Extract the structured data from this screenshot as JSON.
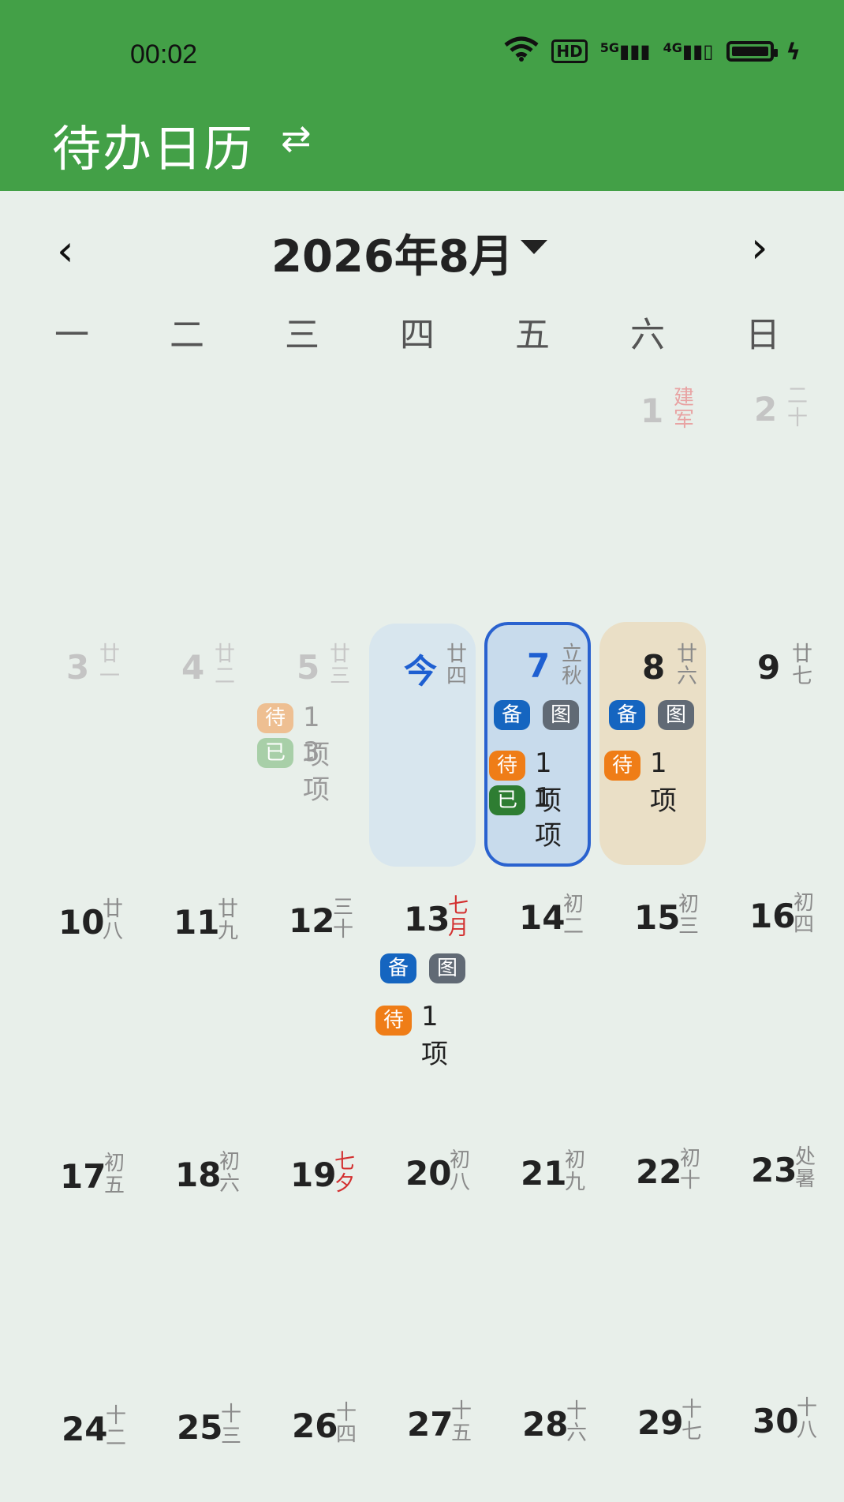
{
  "status": {
    "time": "00:02",
    "icons": [
      "wifi-icon",
      "hd-icon",
      "signal-5g-icon",
      "signal-4g-icon",
      "battery-icon",
      "charging-icon"
    ],
    "hd_label": "HD",
    "g5_label": "5G",
    "g4_label": "4G"
  },
  "appbar": {
    "title": "待办日历",
    "swap_icon": "⇄"
  },
  "calendar": {
    "month_label": "2026年8月",
    "prev": "‹",
    "next": "›",
    "weekdays": [
      "一",
      "二",
      "三",
      "四",
      "五",
      "六",
      "日"
    ]
  },
  "days": {
    "d1": {
      "num": "1",
      "lunar": "建军"
    },
    "d2": {
      "num": "2",
      "lunar": "二十"
    },
    "d3": {
      "num": "3",
      "lunar": "廿一"
    },
    "d4": {
      "num": "4",
      "lunar": "廿二"
    },
    "d5": {
      "num": "5",
      "lunar": "廿三",
      "todo": "待",
      "todo_count": "1项",
      "done": "已",
      "done_count": "3项"
    },
    "d6": {
      "num": "今",
      "lunar": "廿四"
    },
    "d7": {
      "num": "7",
      "lunar": "立秋",
      "memo": "备",
      "pic": "图",
      "todo": "待",
      "todo_count": "1项",
      "done": "已",
      "done_count": "1项"
    },
    "d8": {
      "num": "8",
      "lunar": "廿六",
      "memo": "备",
      "pic": "图",
      "todo": "待",
      "todo_count": "1项"
    },
    "d9": {
      "num": "9",
      "lunar": "廿七"
    },
    "d10": {
      "num": "10",
      "lunar": "廿八"
    },
    "d11": {
      "num": "11",
      "lunar": "廿九"
    },
    "d12": {
      "num": "12",
      "lunar": "三十"
    },
    "d13": {
      "num": "13",
      "lunar": "七月",
      "memo": "备",
      "pic": "图",
      "todo": "待",
      "todo_count": "1项"
    },
    "d14": {
      "num": "14",
      "lunar": "初二"
    },
    "d15": {
      "num": "15",
      "lunar": "初三"
    },
    "d16": {
      "num": "16",
      "lunar": "初四"
    },
    "d17": {
      "num": "17",
      "lunar": "初五"
    },
    "d18": {
      "num": "18",
      "lunar": "初六"
    },
    "d19": {
      "num": "19",
      "lunar": "七夕"
    },
    "d20": {
      "num": "20",
      "lunar": "初八"
    },
    "d21": {
      "num": "21",
      "lunar": "初九"
    },
    "d22": {
      "num": "22",
      "lunar": "初十"
    },
    "d23": {
      "num": "23",
      "lunar": "处暑"
    },
    "d24": {
      "num": "24",
      "lunar": "十二"
    },
    "d25": {
      "num": "25",
      "lunar": "十三"
    },
    "d26": {
      "num": "26",
      "lunar": "十四"
    },
    "d27": {
      "num": "27",
      "lunar": "十五"
    },
    "d28": {
      "num": "28",
      "lunar": "十六"
    },
    "d29": {
      "num": "29",
      "lunar": "十七"
    },
    "d30": {
      "num": "30",
      "lunar": "十八"
    }
  },
  "colors": {
    "appbar": "#43a047",
    "selected_border": "#2a62cf",
    "memo_badge": "#1565c0",
    "todo_badge": "#ef7d17",
    "done_badge": "#2e7d32"
  }
}
